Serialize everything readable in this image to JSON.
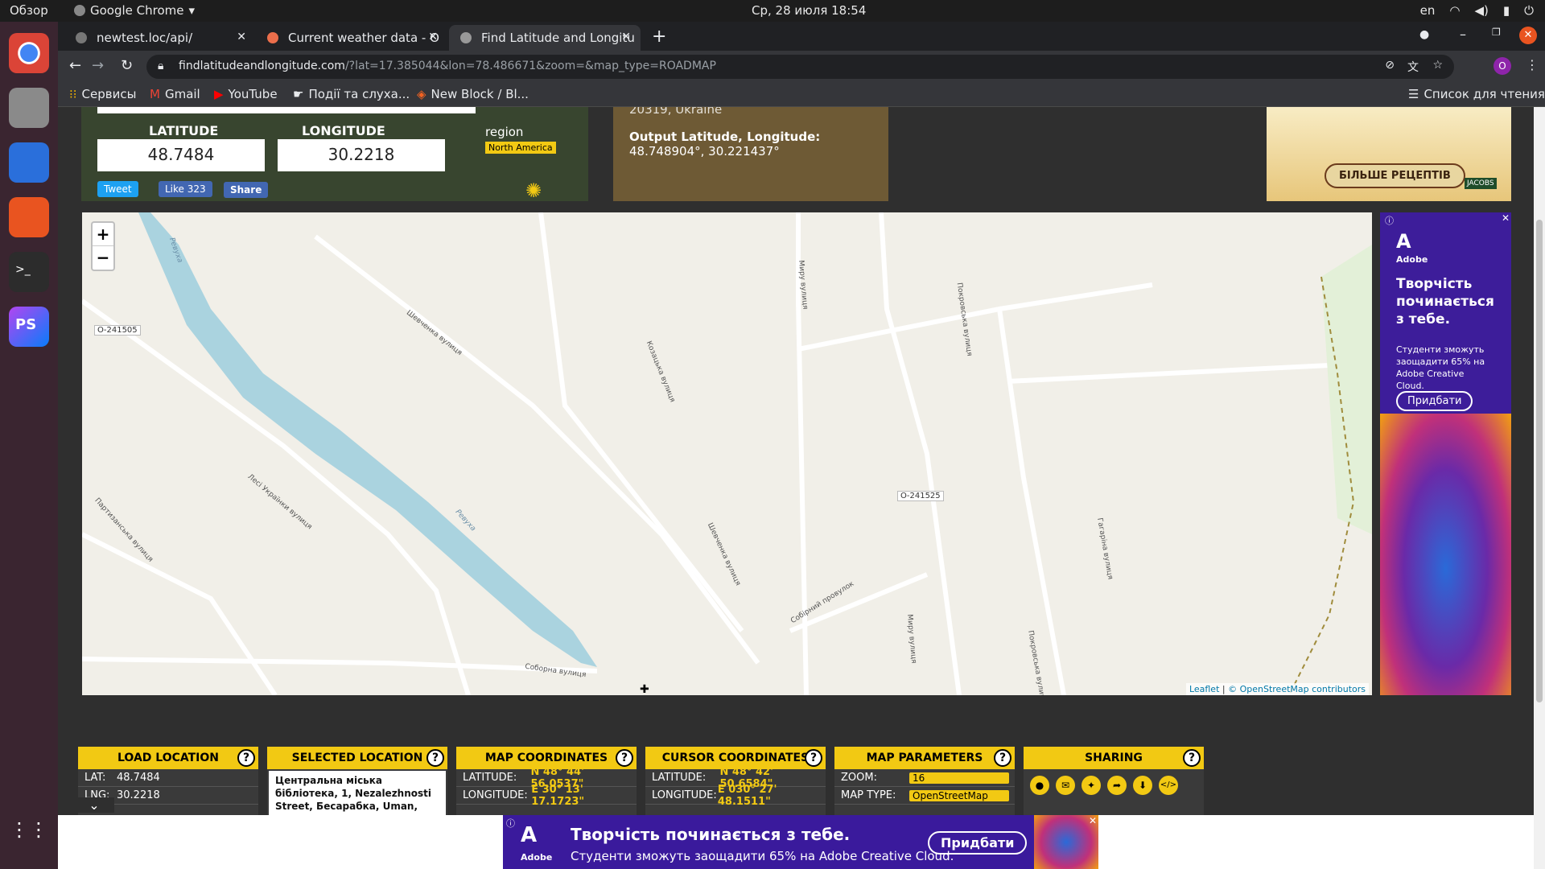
{
  "os": {
    "overview": "Обзор",
    "app_name": "Google Chrome",
    "datetime": "Ср, 28 июля  18:54",
    "lang": "en"
  },
  "tabs": [
    {
      "title": "newtest.loc/api/"
    },
    {
      "title": "Current weather data - O"
    },
    {
      "title": "Find Latitude and Longitu"
    }
  ],
  "url": {
    "host": "findlatitudeandlongitude.com",
    "path": "/?lat=17.385044&lon=78.486671&zoom=&map_type=ROADMAP"
  },
  "bookmarks": [
    "Сервисы",
    "Gmail",
    "YouTube",
    "Події та слуха...",
    "New Block / Bl..."
  ],
  "reading_list": "Список для чтения",
  "top": {
    "lat_label": "LATITUDE",
    "lon_label": "LONGITUDE",
    "lat_value": "48.7484",
    "lon_value": "30.2218",
    "region_label": "region",
    "region_value": "North America",
    "tweet": "Tweet",
    "like": "Like 323",
    "share": "Share",
    "addr_tail": "20319, Ukraine",
    "output_label": "Output Latitude, Longitude:",
    "output_value": "48.748904°, 30.221437°",
    "ad_top_btn": "БІЛЬШЕ РЕЦЕПТІВ",
    "ad_top_brand": "JACOBS"
  },
  "map": {
    "zoom_in": "+",
    "zoom_out": "−",
    "labels": [
      "О-241505",
      "О-241525",
      "Шевченка вулиця",
      "Козацька вулиця",
      "Миру вулиця",
      "Покровська вулиця",
      "Гагаріна вулиця",
      "Собірний провулок",
      "Соборна вулиця",
      "Лесі Українки вулиця",
      "Партизанська вулиця",
      "Ревуха",
      "Ревуха",
      "Шевченка вулиця",
      "Миру вулиця",
      "Покровська вулиця"
    ],
    "attribution_leaflet": "Leaflet",
    "attribution_rest": "© OpenStreetMap contributors"
  },
  "side_ad": {
    "brand": "Adobe",
    "headline": "Творчість починається з тебе.",
    "body": "Студенти зможуть заощадити 65% на Adobe Creative Cloud.",
    "button": "Придбати"
  },
  "panels": {
    "load": {
      "title": "LOAD LOCATION",
      "rows": [
        {
          "k": "LAT:",
          "v": "48.7484"
        },
        {
          "k": "LNG:",
          "v": "30.2218"
        }
      ]
    },
    "selected": {
      "title": "SELECTED LOCATION",
      "text": "Центральна міська бібліотека, 1, Nezalezhnosti Street, Бесарабка, Uman,"
    },
    "mapcoords": {
      "title": "MAP COORDINATES",
      "rows": [
        {
          "k": "LATITUDE:",
          "v": "N 48° 44' 56.0537\""
        },
        {
          "k": "LONGITUDE:",
          "v": "E 30° 13' 17.1723\""
        }
      ]
    },
    "cursor": {
      "title": "CURSOR COORDINATES",
      "rows": [
        {
          "k": "LATITUDE:",
          "v": "N 48° 42' 50.6584\""
        },
        {
          "k": "LONGITUDE:",
          "v": "E 030° 27' 48.1511\""
        }
      ]
    },
    "params": {
      "title": "MAP PARAMETERS",
      "rows": [
        {
          "k": "ZOOM:",
          "v": "16"
        },
        {
          "k": "MAP TYPE:",
          "v": "OpenStreetMap"
        }
      ]
    },
    "sharing": {
      "title": "SHARING"
    }
  },
  "bottom_ad": {
    "brand": "Adobe",
    "headline": "Творчість починається з тебе.",
    "body": "Студенти зможуть заощадити 65% на Adobe Creative Cloud.",
    "button": "Придбати"
  }
}
